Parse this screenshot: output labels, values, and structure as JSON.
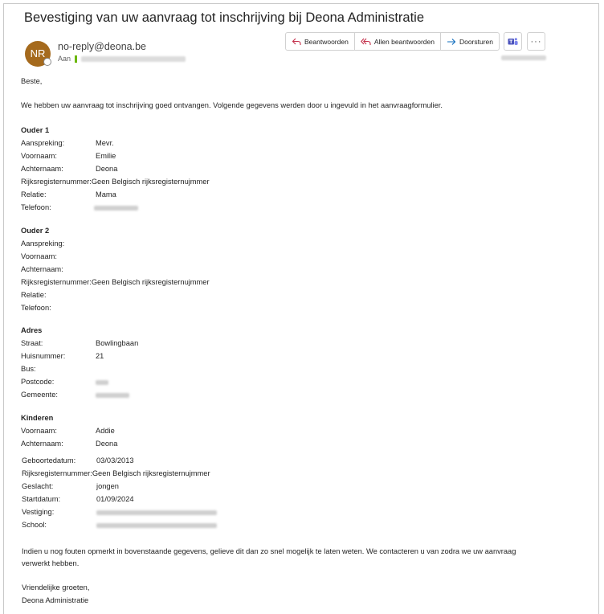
{
  "email": {
    "subject": "Bevestiging van uw aanvraag tot inschrijving bij Deona Administratie",
    "sender": "no-reply@deona.be",
    "avatar_initials": "NR",
    "to_label": "Aan",
    "colors": {
      "avatar": "#a56a1d",
      "accent": "#0f6cbd",
      "teams": "#4b53bc"
    }
  },
  "actions": {
    "reply": "Beantwoorden",
    "reply_all": "Allen beantwoorden",
    "forward": "Doorsturen",
    "more": "···"
  },
  "body": {
    "greeting": "Beste,",
    "intro": "We hebben uw aanvraag tot inschrijving goed ontvangen. Volgende gegevens werden door u ingevuld in het aanvraagformulier.",
    "ouder1": {
      "heading": "Ouder 1",
      "rows": [
        {
          "label": "Aanspreking:",
          "value": "Mevr."
        },
        {
          "label": "Voornaam:",
          "value": "Emilie"
        },
        {
          "label": "Achternaam:",
          "value": "Deona"
        },
        {
          "label": "Rijksregisternummer:",
          "value": "Geen Belgisch rijksregisternujmmer"
        },
        {
          "label": "Relatie:",
          "value": "Mama"
        },
        {
          "label": "Telefoon:",
          "value": ""
        }
      ]
    },
    "ouder2": {
      "heading": "Ouder 2",
      "rows": [
        {
          "label": "Aanspreking:",
          "value": ""
        },
        {
          "label": "Voornaam:",
          "value": ""
        },
        {
          "label": "Achternaam:",
          "value": ""
        },
        {
          "label": "Rijksregisternummer:",
          "value": "Geen Belgisch rijksregisternujmmer"
        },
        {
          "label": "Relatie:",
          "value": ""
        },
        {
          "label": "Telefoon:",
          "value": ""
        }
      ]
    },
    "adres": {
      "heading": "Adres",
      "rows": [
        {
          "label": "Straat:",
          "value": "Bowlingbaan"
        },
        {
          "label": "Huisnummer:",
          "value": "21"
        },
        {
          "label": "Bus:",
          "value": ""
        },
        {
          "label": "Postcode:",
          "value": ""
        },
        {
          "label": "Gemeente:",
          "value": ""
        }
      ]
    },
    "kinderen": {
      "heading": "Kinderen",
      "rows": [
        {
          "label": "Voornaam:",
          "value": "Addie"
        },
        {
          "label": "Achternaam:",
          "value": "Deona"
        },
        {
          "label": "Geboortedatum:",
          "value": "03/03/2013"
        },
        {
          "label": "Rijksregisternummer:",
          "value": "Geen Belgisch rijksregisternujmmer"
        },
        {
          "label": "Geslacht:",
          "value": "jongen"
        },
        {
          "label": "Startdatum:",
          "value": "01/09/2024"
        },
        {
          "label": "Vestiging:",
          "value": ""
        },
        {
          "label": "School:",
          "value": ""
        }
      ]
    },
    "closing_line1": "Indien u nog fouten opmerkt in bovenstaande gegevens, gelieve dit dan zo snel mogelijk te laten weten. We contacteren u van zodra we uw aanvraag",
    "closing_line2": "verwerkt hebben.",
    "regards": "Vriendelijke groeten,",
    "signature": "Deona Administratie"
  }
}
